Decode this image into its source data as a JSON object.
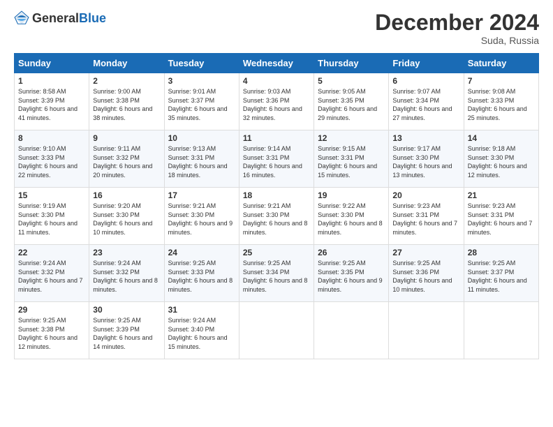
{
  "logo": {
    "general": "General",
    "blue": "Blue"
  },
  "title": "December 2024",
  "location": "Suda, Russia",
  "weekdays": [
    "Sunday",
    "Monday",
    "Tuesday",
    "Wednesday",
    "Thursday",
    "Friday",
    "Saturday"
  ],
  "weeks": [
    [
      {
        "day": 1,
        "sunrise": "8:58 AM",
        "sunset": "3:39 PM",
        "daylight": "6 hours and 41 minutes."
      },
      {
        "day": 2,
        "sunrise": "9:00 AM",
        "sunset": "3:38 PM",
        "daylight": "6 hours and 38 minutes."
      },
      {
        "day": 3,
        "sunrise": "9:01 AM",
        "sunset": "3:37 PM",
        "daylight": "6 hours and 35 minutes."
      },
      {
        "day": 4,
        "sunrise": "9:03 AM",
        "sunset": "3:36 PM",
        "daylight": "6 hours and 32 minutes."
      },
      {
        "day": 5,
        "sunrise": "9:05 AM",
        "sunset": "3:35 PM",
        "daylight": "6 hours and 29 minutes."
      },
      {
        "day": 6,
        "sunrise": "9:07 AM",
        "sunset": "3:34 PM",
        "daylight": "6 hours and 27 minutes."
      },
      {
        "day": 7,
        "sunrise": "9:08 AM",
        "sunset": "3:33 PM",
        "daylight": "6 hours and 25 minutes."
      }
    ],
    [
      {
        "day": 8,
        "sunrise": "9:10 AM",
        "sunset": "3:33 PM",
        "daylight": "6 hours and 22 minutes."
      },
      {
        "day": 9,
        "sunrise": "9:11 AM",
        "sunset": "3:32 PM",
        "daylight": "6 hours and 20 minutes."
      },
      {
        "day": 10,
        "sunrise": "9:13 AM",
        "sunset": "3:31 PM",
        "daylight": "6 hours and 18 minutes."
      },
      {
        "day": 11,
        "sunrise": "9:14 AM",
        "sunset": "3:31 PM",
        "daylight": "6 hours and 16 minutes."
      },
      {
        "day": 12,
        "sunrise": "9:15 AM",
        "sunset": "3:31 PM",
        "daylight": "6 hours and 15 minutes."
      },
      {
        "day": 13,
        "sunrise": "9:17 AM",
        "sunset": "3:30 PM",
        "daylight": "6 hours and 13 minutes."
      },
      {
        "day": 14,
        "sunrise": "9:18 AM",
        "sunset": "3:30 PM",
        "daylight": "6 hours and 12 minutes."
      }
    ],
    [
      {
        "day": 15,
        "sunrise": "9:19 AM",
        "sunset": "3:30 PM",
        "daylight": "6 hours and 11 minutes."
      },
      {
        "day": 16,
        "sunrise": "9:20 AM",
        "sunset": "3:30 PM",
        "daylight": "6 hours and 10 minutes."
      },
      {
        "day": 17,
        "sunrise": "9:21 AM",
        "sunset": "3:30 PM",
        "daylight": "6 hours and 9 minutes."
      },
      {
        "day": 18,
        "sunrise": "9:21 AM",
        "sunset": "3:30 PM",
        "daylight": "6 hours and 8 minutes."
      },
      {
        "day": 19,
        "sunrise": "9:22 AM",
        "sunset": "3:30 PM",
        "daylight": "6 hours and 8 minutes."
      },
      {
        "day": 20,
        "sunrise": "9:23 AM",
        "sunset": "3:31 PM",
        "daylight": "6 hours and 7 minutes."
      },
      {
        "day": 21,
        "sunrise": "9:23 AM",
        "sunset": "3:31 PM",
        "daylight": "6 hours and 7 minutes."
      }
    ],
    [
      {
        "day": 22,
        "sunrise": "9:24 AM",
        "sunset": "3:32 PM",
        "daylight": "6 hours and 7 minutes."
      },
      {
        "day": 23,
        "sunrise": "9:24 AM",
        "sunset": "3:32 PM",
        "daylight": "6 hours and 8 minutes."
      },
      {
        "day": 24,
        "sunrise": "9:25 AM",
        "sunset": "3:33 PM",
        "daylight": "6 hours and 8 minutes."
      },
      {
        "day": 25,
        "sunrise": "9:25 AM",
        "sunset": "3:34 PM",
        "daylight": "6 hours and 8 minutes."
      },
      {
        "day": 26,
        "sunrise": "9:25 AM",
        "sunset": "3:35 PM",
        "daylight": "6 hours and 9 minutes."
      },
      {
        "day": 27,
        "sunrise": "9:25 AM",
        "sunset": "3:36 PM",
        "daylight": "6 hours and 10 minutes."
      },
      {
        "day": 28,
        "sunrise": "9:25 AM",
        "sunset": "3:37 PM",
        "daylight": "6 hours and 11 minutes."
      }
    ],
    [
      {
        "day": 29,
        "sunrise": "9:25 AM",
        "sunset": "3:38 PM",
        "daylight": "6 hours and 12 minutes."
      },
      {
        "day": 30,
        "sunrise": "9:25 AM",
        "sunset": "3:39 PM",
        "daylight": "6 hours and 14 minutes."
      },
      {
        "day": 31,
        "sunrise": "9:24 AM",
        "sunset": "3:40 PM",
        "daylight": "6 hours and 15 minutes."
      },
      null,
      null,
      null,
      null
    ]
  ]
}
